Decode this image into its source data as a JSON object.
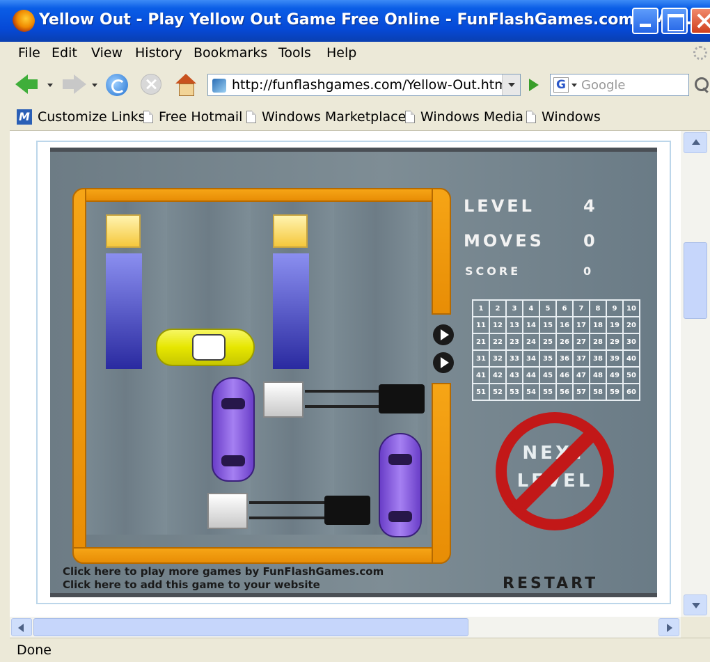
{
  "window": {
    "title": "Yellow Out - Play Yellow Out Game Free Online - FunFlashGames.com - Moz...",
    "minimize_icon": "minimize-icon",
    "maximize_icon": "maximize-icon",
    "close_icon": "close-icon"
  },
  "menu": {
    "items": [
      {
        "label": "File"
      },
      {
        "label": "Edit"
      },
      {
        "label": "View"
      },
      {
        "label": "History"
      },
      {
        "label": "Bookmarks"
      },
      {
        "label": "Tools"
      },
      {
        "label": "Help"
      }
    ]
  },
  "nav": {
    "url": "http://funflashgames.com/Yellow-Out.html",
    "search_placeholder": "Google",
    "search_engine_glyph": "G"
  },
  "bookmarks": {
    "items": [
      {
        "label": "Customize Links",
        "icon": "msn-icon"
      },
      {
        "label": "Free Hotmail",
        "icon": "page-icon"
      },
      {
        "label": "Windows Marketplace",
        "icon": "page-icon"
      },
      {
        "label": "Windows Media",
        "icon": "page-icon"
      },
      {
        "label": "Windows",
        "icon": "page-icon"
      }
    ]
  },
  "game": {
    "level_label": "LEVEL",
    "level_value": "4",
    "moves_label": "MOVES",
    "moves_value": "0",
    "score_label": "SCORE",
    "score_value": "0",
    "level_grid": [
      [
        "1",
        "2",
        "3",
        "4",
        "5",
        "6",
        "7",
        "8",
        "9",
        "10"
      ],
      [
        "11",
        "12",
        "13",
        "14",
        "15",
        "16",
        "17",
        "18",
        "19",
        "20"
      ],
      [
        "21",
        "22",
        "23",
        "24",
        "25",
        "26",
        "27",
        "28",
        "29",
        "30"
      ],
      [
        "31",
        "32",
        "33",
        "34",
        "35",
        "36",
        "37",
        "38",
        "39",
        "40"
      ],
      [
        "41",
        "42",
        "43",
        "44",
        "45",
        "46",
        "47",
        "48",
        "49",
        "50"
      ],
      [
        "51",
        "52",
        "53",
        "54",
        "55",
        "56",
        "57",
        "58",
        "59",
        "60"
      ]
    ],
    "next_level_line1": "NEXT",
    "next_level_line2": "LEVEL",
    "restart_label": "RESTART",
    "more_games_link": "Click here to play more games by FunFlashGames.com",
    "add_game_link": "Click here to add this game to your website",
    "colors": {
      "wall": "#f6a516",
      "target_car": "#e6e600",
      "blocker_car": "#8a5fe0",
      "no_sign": "#c21818"
    }
  },
  "status": {
    "text": "Done"
  }
}
